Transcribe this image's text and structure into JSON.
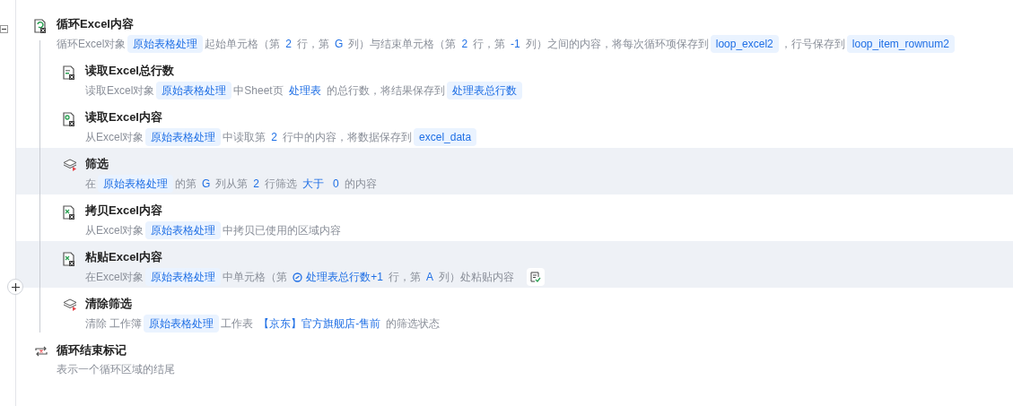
{
  "steps": [
    {
      "kind": "loop",
      "title": "循环Excel内容",
      "highlighted": false,
      "collapsed": false,
      "parts": [
        {
          "kind": "text",
          "text": "循环Excel对象"
        },
        {
          "kind": "tag",
          "text": "原始表格处理"
        },
        {
          "kind": "text",
          "text": "起始单元格（第"
        },
        {
          "kind": "value",
          "text": "2"
        },
        {
          "kind": "text",
          "text": "行，第"
        },
        {
          "kind": "value",
          "text": "G"
        },
        {
          "kind": "text",
          "text": "列）与结束单元格（第"
        },
        {
          "kind": "value",
          "text": "2"
        },
        {
          "kind": "text",
          "text": "行，第"
        },
        {
          "kind": "value",
          "text": "-1"
        },
        {
          "kind": "text",
          "text": "列）之间的内容，将每次循环项保存到"
        },
        {
          "kind": "tag",
          "text": "loop_excel2"
        },
        {
          "kind": "text",
          "text": "，行号保存到"
        },
        {
          "kind": "tag",
          "text": "loop_item_rownum2"
        }
      ],
      "children": [
        {
          "kind": "count",
          "title": "读取Excel总行数",
          "highlighted": false,
          "flag": false,
          "parts": [
            {
              "kind": "text",
              "text": "读取Excel对象"
            },
            {
              "kind": "tag",
              "text": "原始表格处理"
            },
            {
              "kind": "text",
              "text": "中Sheet页"
            },
            {
              "kind": "value",
              "text": "处理表"
            },
            {
              "kind": "text",
              "text": "的总行数，将结果保存到"
            },
            {
              "kind": "tag",
              "text": "处理表总行数"
            }
          ]
        },
        {
          "kind": "read",
          "title": "读取Excel内容",
          "highlighted": false,
          "flag": false,
          "parts": [
            {
              "kind": "text",
              "text": "从Excel对象"
            },
            {
              "kind": "tag",
              "text": "原始表格处理"
            },
            {
              "kind": "text",
              "text": "中读取第"
            },
            {
              "kind": "value",
              "text": "2"
            },
            {
              "kind": "text",
              "text": "行中的内容，将数据保存到"
            },
            {
              "kind": "tag",
              "text": "excel_data"
            }
          ]
        },
        {
          "kind": "filter",
          "title": "筛选",
          "highlighted": true,
          "flag": false,
          "parts": [
            {
              "kind": "text",
              "text": "在"
            },
            {
              "kind": "tag",
              "text": "原始表格处理"
            },
            {
              "kind": "text",
              "text": "的第"
            },
            {
              "kind": "value",
              "text": "G"
            },
            {
              "kind": "text",
              "text": "列从第"
            },
            {
              "kind": "value",
              "text": "2"
            },
            {
              "kind": "text",
              "text": "行筛选"
            },
            {
              "kind": "value",
              "text": "大于"
            },
            {
              "kind": "value",
              "text": "0"
            },
            {
              "kind": "text",
              "text": "的内容"
            }
          ]
        },
        {
          "kind": "copy",
          "title": "拷贝Excel内容",
          "highlighted": false,
          "flag": false,
          "parts": [
            {
              "kind": "text",
              "text": "从Excel对象"
            },
            {
              "kind": "tag",
              "text": "原始表格处理"
            },
            {
              "kind": "text",
              "text": "中拷贝已使用的区域内容"
            }
          ]
        },
        {
          "kind": "paste",
          "title": "粘贴Excel内容",
          "highlighted": true,
          "flag": true,
          "parts": [
            {
              "kind": "text",
              "text": "在Excel对象"
            },
            {
              "kind": "tag",
              "text": "原始表格处理"
            },
            {
              "kind": "text",
              "text": "中单元格（第"
            },
            {
              "kind": "var",
              "text": "处理表总行数+1"
            },
            {
              "kind": "text",
              "text": "行，第"
            },
            {
              "kind": "value",
              "text": "A"
            },
            {
              "kind": "text",
              "text": "列）处粘贴内容"
            }
          ]
        },
        {
          "kind": "filter",
          "title": "清除筛选",
          "highlighted": false,
          "flag": false,
          "parts": [
            {
              "kind": "text",
              "text": "清除 工作簿"
            },
            {
              "kind": "tag",
              "text": "原始表格处理"
            },
            {
              "kind": "text",
              "text": "工作表"
            },
            {
              "kind": "value",
              "text": "【京东】官方旗舰店-售前"
            },
            {
              "kind": "text",
              "text": "的筛选状态"
            }
          ]
        }
      ]
    },
    {
      "kind": "loop-end",
      "title": "循环结束标记",
      "highlighted": false,
      "parts": [
        {
          "kind": "text",
          "text": "表示一个循环区域的结尾"
        }
      ]
    }
  ]
}
